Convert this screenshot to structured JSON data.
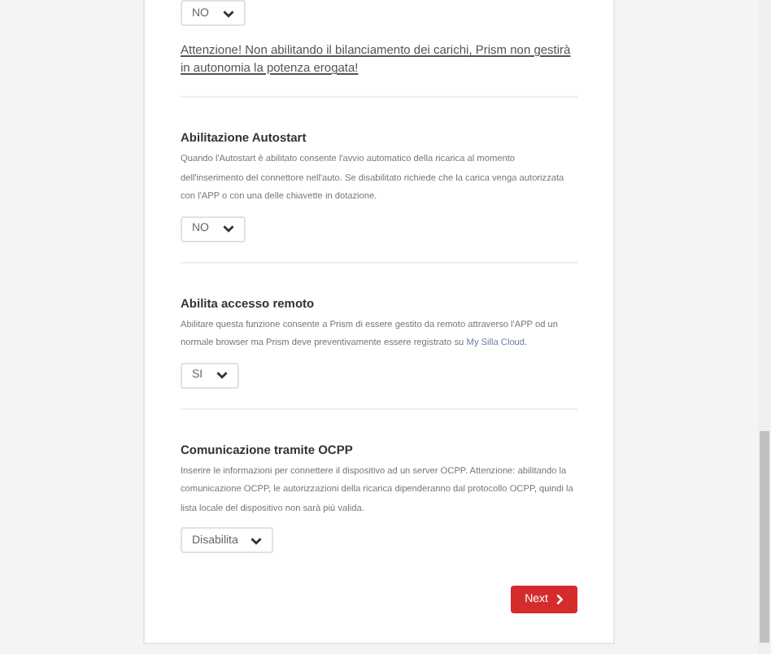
{
  "top_select": {
    "value": "NO"
  },
  "warning": "Attenzione! Non abilitando il bilanciamento dei carichi, Prism non gestirà in autonomia la potenza erogata!",
  "sections": [
    {
      "title": "Abilitazione Autostart",
      "description": "Quando l'Autostart è abilitato consente l'avvio automatico della ricarica al momento dell'inserimento del connettore nell'auto. Se disabilitato richiede che la carica venga autorizzata con l'APP o con una delle chiavette in dotazione.",
      "select": "NO"
    },
    {
      "title": "Abilita accesso remoto",
      "description": "Abilitare questa funzione consente a Prism di essere gestito da remoto attraverso l'APP od un normale browser ma Prism deve preventivamente essere registrato su",
      "link": "My Silla Cloud.",
      "select": "SI"
    },
    {
      "title": "Comunicazione tramite OCPP",
      "description": "Inserire le informazioni per connettere il dispositivo ad un server OCPP. Attenzione: abilitando la comunicazione OCPP, le autorizzazioni della ricarica dipenderanno dal protocollo OCPP, quindi la lista locale del dispositivo non sarà più valida.",
      "select": "Disabilita"
    }
  ],
  "next_button": "Next"
}
